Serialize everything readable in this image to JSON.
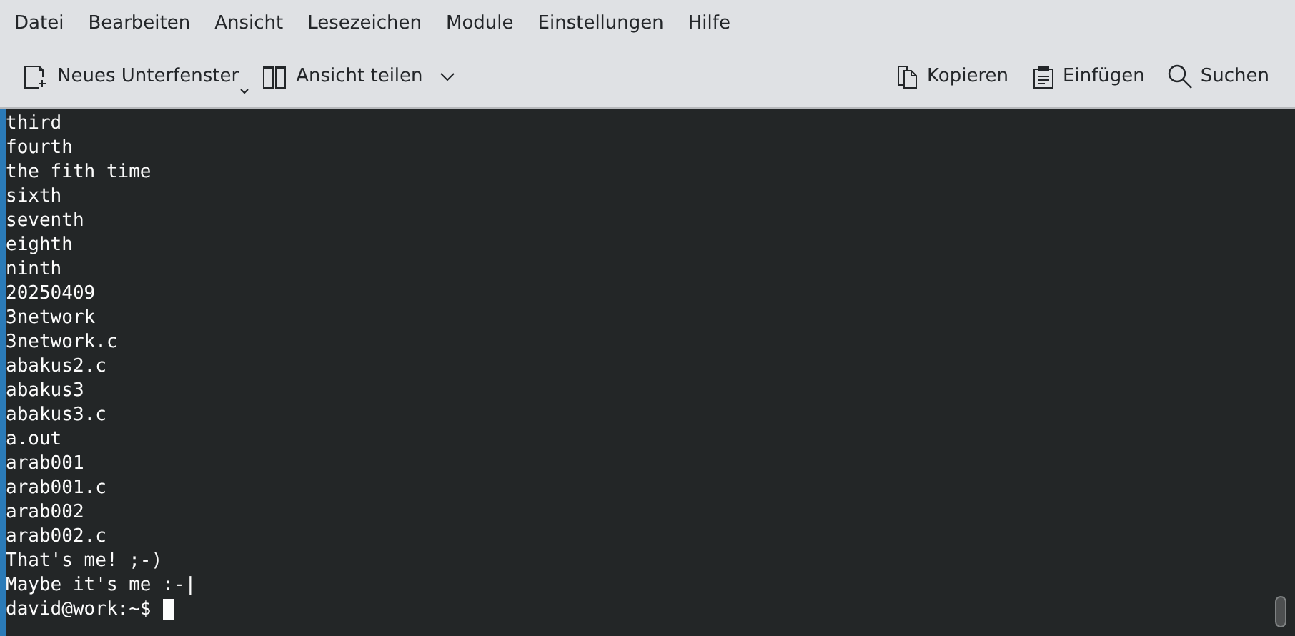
{
  "menu_bar": [
    "Datei",
    "Bearbeiten",
    "Ansicht",
    "Lesezeichen",
    "Module",
    "Einstellungen",
    "Hilfe"
  ],
  "toolbar": {
    "left": [
      {
        "kind": "new-tab",
        "label": "Neues Unterfenster"
      },
      {
        "kind": "split",
        "label": "Ansicht teilen"
      }
    ],
    "right": [
      {
        "kind": "copy",
        "label": "Kopieren"
      },
      {
        "kind": "paste",
        "label": "Einfügen"
      },
      {
        "kind": "search",
        "label": "Suchen"
      }
    ]
  },
  "terminal": {
    "lines": [
      "third",
      "fourth",
      "the fith time",
      "sixth",
      "seventh",
      "eighth",
      "ninth",
      "20250409",
      "3network",
      "3network.c",
      "abakus2.c",
      "abakus3",
      "abakus3.c",
      "a.out",
      "arab001",
      "arab001.c",
      "arab002",
      "arab002.c",
      "That's me! ;-)",
      "Maybe it's me :-|"
    ],
    "prompt": "david@work:~$"
  }
}
